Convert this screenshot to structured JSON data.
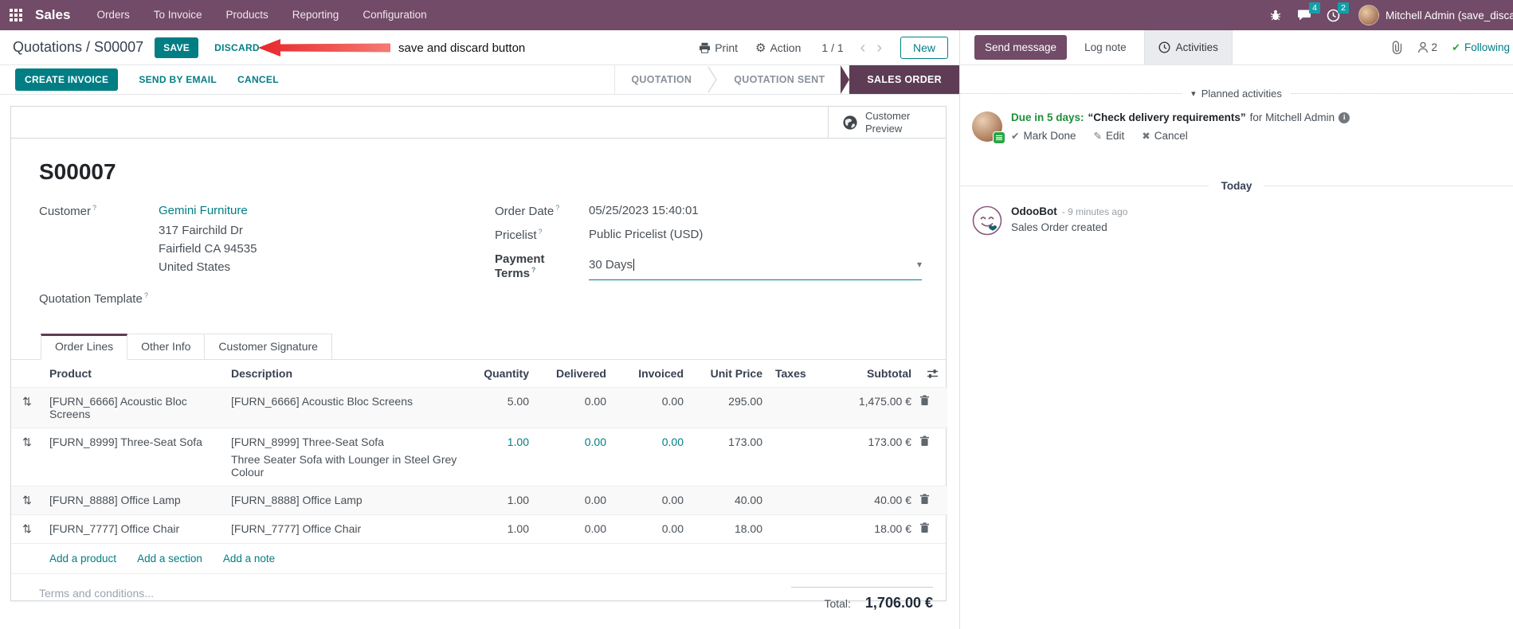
{
  "colors": {
    "brand_purple": "#714B67",
    "stage_active": "#5F3C56",
    "accent_teal": "#017E84",
    "badge_teal": "#13A0A8",
    "success_green": "#28a745",
    "annotation_red": "#E8262A"
  },
  "icons": {
    "help": "?",
    "gear": "⚙",
    "dropdown_caret": "▾",
    "section_caret": "▾",
    "chevron_left": "‹",
    "chevron_right": "›",
    "check": "✔",
    "pencil": "✎",
    "x": "✖",
    "drag_handle": "⇅",
    "info": "i"
  },
  "nav": {
    "app": "Sales",
    "items": [
      "Orders",
      "To Invoice",
      "Products",
      "Reporting",
      "Configuration"
    ],
    "messages_count": "4",
    "activities_count": "2",
    "user": "Mitchell Admin (save_discar"
  },
  "control": {
    "breadcrumb": "Quotations / S00007",
    "save": "SAVE",
    "discard": "DISCARD",
    "print": "Print",
    "action": "Action",
    "pager": "1 / 1",
    "new": "New"
  },
  "annotation": {
    "text": "save and discard button"
  },
  "statusbar": {
    "create_invoice": "CREATE INVOICE",
    "send_by_email": "SEND BY EMAIL",
    "cancel": "CANCEL",
    "stages": [
      {
        "label": "QUOTATION"
      },
      {
        "label": "QUOTATION SENT"
      },
      {
        "label": "SALES ORDER"
      }
    ]
  },
  "sheet": {
    "preview_line1": "Customer",
    "preview_line2": "Preview",
    "title": "S00007",
    "fields": {
      "customer_label": "Customer",
      "customer_name": "Gemini Furniture",
      "address": [
        "317 Fairchild Dr",
        "Fairfield CA 94535",
        "United States"
      ],
      "quotation_template_label": "Quotation Template",
      "order_date_label": "Order Date",
      "order_date": "05/25/2023 15:40:01",
      "pricelist_label": "Pricelist",
      "pricelist": "Public Pricelist (USD)",
      "payment_terms_label": "Payment Terms",
      "payment_terms": "30 Days"
    },
    "tabs": [
      "Order Lines",
      "Other Info",
      "Customer Signature"
    ],
    "table": {
      "headers": [
        "Product",
        "Description",
        "Quantity",
        "Delivered",
        "Invoiced",
        "Unit Price",
        "Taxes",
        "Subtotal"
      ],
      "rows": [
        {
          "product": "[FURN_6666] Acoustic Bloc Screens",
          "description": "[FURN_6666] Acoustic Bloc Screens",
          "description2": "",
          "quantity": "5.00",
          "delivered": "0.00",
          "invoiced": "0.00",
          "unit_price": "295.00",
          "taxes": "",
          "subtotal": "1,475.00 €"
        },
        {
          "product": "[FURN_8999] Three-Seat Sofa",
          "description": "[FURN_8999] Three-Seat Sofa",
          "description2": "Three Seater Sofa with Lounger in Steel Grey Colour",
          "quantity": "1.00",
          "delivered": "0.00",
          "invoiced": "0.00",
          "unit_price": "173.00",
          "taxes": "",
          "subtotal": "173.00 €"
        },
        {
          "product": "[FURN_8888] Office Lamp",
          "description": "[FURN_8888] Office Lamp",
          "description2": "",
          "quantity": "1.00",
          "delivered": "0.00",
          "invoiced": "0.00",
          "unit_price": "40.00",
          "taxes": "",
          "subtotal": "40.00 €"
        },
        {
          "product": "[FURN_7777] Office Chair",
          "description": "[FURN_7777] Office Chair",
          "description2": "",
          "quantity": "1.00",
          "delivered": "0.00",
          "invoiced": "0.00",
          "unit_price": "18.00",
          "taxes": "",
          "subtotal": "18.00 €"
        }
      ],
      "links": [
        "Add a product",
        "Add a section",
        "Add a note"
      ]
    },
    "terms_placeholder": "Terms and conditions...",
    "total_label": "Total:",
    "total_value": "1,706.00 €"
  },
  "chatter": {
    "send_message": "Send message",
    "log_note": "Log note",
    "activities": "Activities",
    "followers_count": "2",
    "following": "Following",
    "planned_header": "Planned activities",
    "activity": {
      "due": "Due in 5 days:",
      "title": "“Check delivery requirements”",
      "for_text": "for Mitchell Admin",
      "mark_done": "Mark Done",
      "edit": "Edit",
      "cancel": "Cancel"
    },
    "today": "Today",
    "message": {
      "author": "OdooBot",
      "time": "- 9 minutes ago",
      "body": "Sales Order created"
    }
  }
}
